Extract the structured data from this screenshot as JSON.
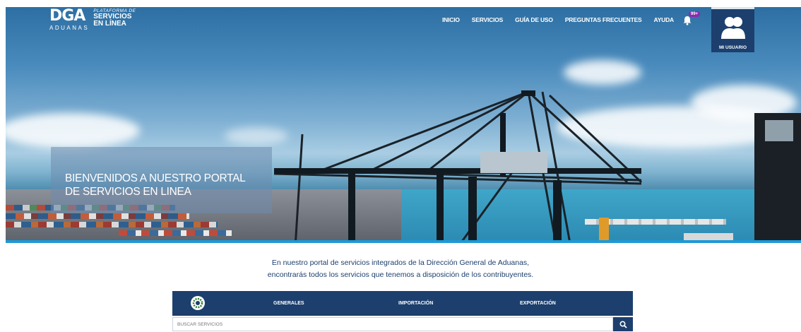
{
  "brand": {
    "dga": "DGA",
    "aduanas": "ADUANAS",
    "platform_small": "PLATAFORMA DE",
    "platform_line1": "SERVICIOS",
    "platform_line2": "EN LÍNEA"
  },
  "nav": {
    "items": [
      {
        "label": "INICIO"
      },
      {
        "label": "SERVICIOS"
      },
      {
        "label": "GUÍA DE USO"
      },
      {
        "label": "PREGUNTAS FRECUENTES"
      },
      {
        "label": "AYUDA"
      }
    ],
    "notifications_badge": "99+",
    "user_label": "MI USUARIO"
  },
  "hero": {
    "welcome_line1": "BIENVENIDOS A NUESTRO PORTAL",
    "welcome_line2": "DE SERVICIOS EN LINEA"
  },
  "intro": {
    "line1": "En nuestro portal de servicios integrados de la Dirección General de Aduanas,",
    "line2": "encontrarás todos los servicios que tenemos a disposición de los contribuyentes."
  },
  "tabs": [
    {
      "label": "GENERALES"
    },
    {
      "label": "IMPORTACIÓN"
    },
    {
      "label": "EXPORTACIÓN"
    }
  ],
  "search": {
    "placeholder": "BUSCAR SERVICIOS"
  },
  "colors": {
    "primary": "#1c3f6e",
    "accent_bar": "#1d9ad6",
    "badge": "#8a2bb0"
  }
}
